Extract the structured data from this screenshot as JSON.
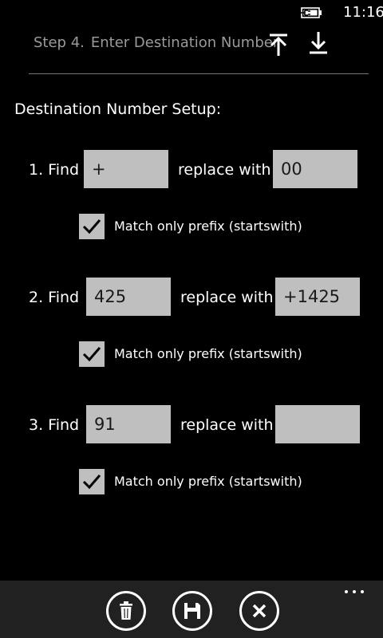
{
  "status_bar": {
    "time": "11:16",
    "battery_icon": "battery-charging-icon"
  },
  "header": {
    "step": "Step 4.",
    "title": "Enter Destination Number",
    "move_top_icon": "arrow-to-top-icon",
    "move_bottom_icon": "arrow-to-bottom-icon"
  },
  "section_title": "Destination Number Setup:",
  "rules": [
    {
      "label": "1. Find",
      "find_value": "+",
      "replace_label": "replace with",
      "replace_value": "00",
      "prefix_checked": true,
      "prefix_label": "Match only prefix (startswith)"
    },
    {
      "label": "2. Find",
      "find_value": "425",
      "replace_label": "replace with",
      "replace_value": "+1425",
      "prefix_checked": true,
      "prefix_label": "Match only prefix (startswith)"
    },
    {
      "label": "3. Find",
      "find_value": "91",
      "replace_label": "replace with",
      "replace_value": "",
      "prefix_checked": true,
      "prefix_label": "Match only prefix (startswith)"
    }
  ],
  "app_bar": {
    "buttons": [
      "delete-icon",
      "save-icon",
      "cancel-icon"
    ],
    "more_icon": "more-ellipsis-icon"
  },
  "colors": {
    "background": "#000000",
    "input_background": "#bfbfbf",
    "app_bar_background": "#212121",
    "header_text": "#9a9a9a"
  }
}
